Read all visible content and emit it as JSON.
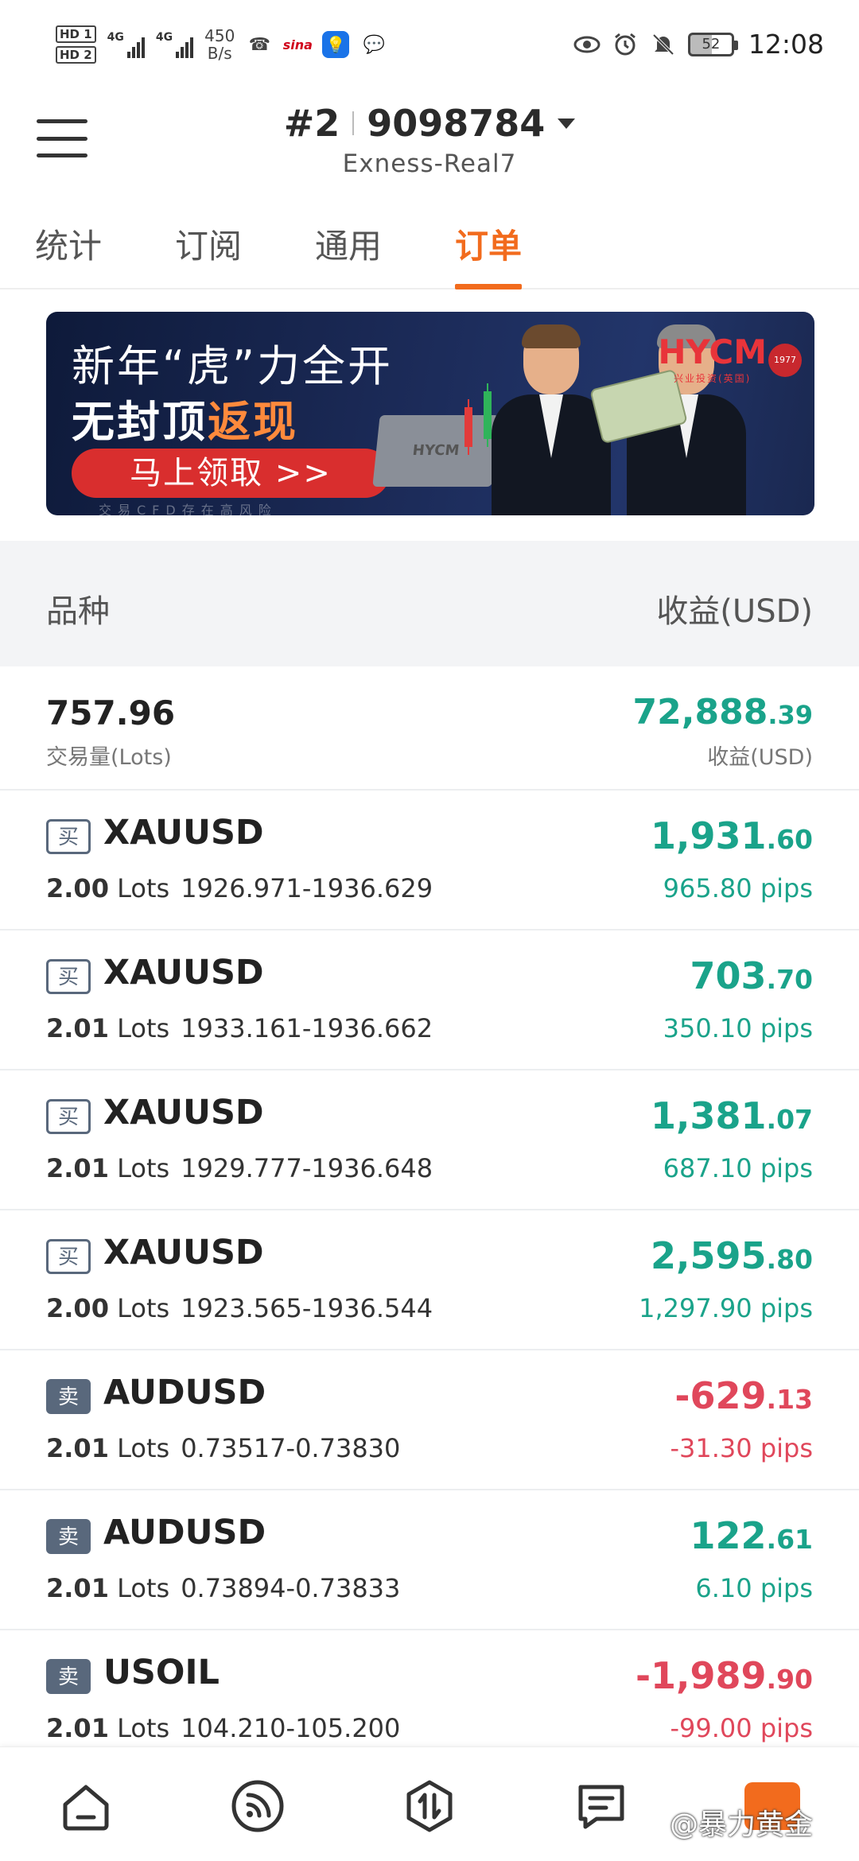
{
  "status_bar": {
    "hd1": "HD 1",
    "hd2": "HD 2",
    "sig1": "4G",
    "sig2": "4G",
    "speed_value": "450",
    "speed_unit": "B/s",
    "sina": "sina",
    "battery": "52",
    "time": "12:08"
  },
  "header": {
    "account_prefix": "#2",
    "account_number": "9098784",
    "server": "Exness-Real7"
  },
  "tabs": [
    {
      "label": "统计"
    },
    {
      "label": "订阅"
    },
    {
      "label": "通用"
    },
    {
      "label": "订单"
    }
  ],
  "banner": {
    "line1": "新年“虎”力全开",
    "line2_a": "无封顶",
    "line2_b": "返现",
    "button": "马上领取 >>",
    "risk": "交易CFD存在高风险",
    "logo": "HYCM",
    "logo_sub": "兴业投资(英国)",
    "seal": "1977",
    "laptop": "HYCM"
  },
  "table_header": {
    "left": "品种",
    "right": "收益(USD)"
  },
  "summary": {
    "lots": "757.96",
    "lots_label": "交易量(Lots)",
    "profit_main": "72,888",
    "profit_dec": ".39",
    "profit_label": "收益(USD)"
  },
  "orders": [
    {
      "side": "买",
      "symbol": "XAUUSD",
      "lots": "2.00",
      "lots_unit": "Lots",
      "prices": "1926.971-1936.629",
      "profit_main": "1,931",
      "profit_dec": ".60",
      "pips": "965.80 pips",
      "positive": true
    },
    {
      "side": "买",
      "symbol": "XAUUSD",
      "lots": "2.01",
      "lots_unit": "Lots",
      "prices": "1933.161-1936.662",
      "profit_main": "703",
      "profit_dec": ".70",
      "pips": "350.10 pips",
      "positive": true
    },
    {
      "side": "买",
      "symbol": "XAUUSD",
      "lots": "2.01",
      "lots_unit": "Lots",
      "prices": "1929.777-1936.648",
      "profit_main": "1,381",
      "profit_dec": ".07",
      "pips": "687.10 pips",
      "positive": true
    },
    {
      "side": "买",
      "symbol": "XAUUSD",
      "lots": "2.00",
      "lots_unit": "Lots",
      "prices": "1923.565-1936.544",
      "profit_main": "2,595",
      "profit_dec": ".80",
      "pips": "1,297.90 pips",
      "positive": true
    },
    {
      "side": "卖",
      "symbol": "AUDUSD",
      "lots": "2.01",
      "lots_unit": "Lots",
      "prices": "0.73517-0.73830",
      "profit_main": "-629",
      "profit_dec": ".13",
      "pips": "-31.30 pips",
      "positive": false
    },
    {
      "side": "卖",
      "symbol": "AUDUSD",
      "lots": "2.01",
      "lots_unit": "Lots",
      "prices": "0.73894-0.73833",
      "profit_main": "122",
      "profit_dec": ".61",
      "pips": "6.10 pips",
      "positive": true
    },
    {
      "side": "卖",
      "symbol": "USOIL",
      "lots": "2.01",
      "lots_unit": "Lots",
      "prices": "104.210-105.200",
      "profit_main": "-1,989",
      "profit_dec": ".90",
      "pips": "-99.00 pips",
      "positive": false
    }
  ],
  "bottom_nav": {
    "items": [
      {
        "icon": "home-icon"
      },
      {
        "icon": "signal-icon"
      },
      {
        "icon": "trade-icon"
      },
      {
        "icon": "messages-icon"
      },
      {
        "icon": "profile-icon"
      }
    ],
    "watermark": "@暴力黄金"
  },
  "colors": {
    "accent": "#f26b1d",
    "profit_positive": "#1aa38a",
    "profit_negative": "#e0475b"
  }
}
